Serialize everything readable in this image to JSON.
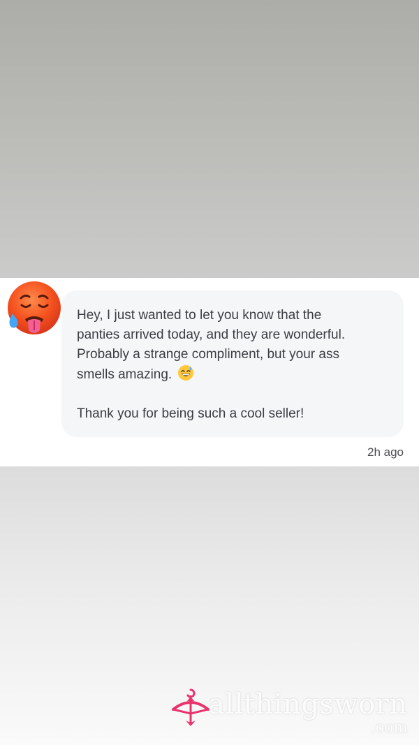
{
  "avatar": {
    "icon": "hot-face-emoji-icon",
    "color": "#f4511e"
  },
  "message": {
    "lines": [
      "Hey, I just wanted to let you know that the",
      "panties arrived today, and they are wonderful.",
      "Probably a strange compliment, but your ass",
      "smells amazing."
    ],
    "inline_emoji": "grinning-sweat-emoji-icon",
    "closing": "Thank you for being such a cool seller!",
    "timestamp": "2h ago"
  },
  "watermark": {
    "text": "allthingsworn",
    "suffix": ".com",
    "logo_icon": "hanger-bow-arrow-icon",
    "logo_color": "#e8336d"
  }
}
